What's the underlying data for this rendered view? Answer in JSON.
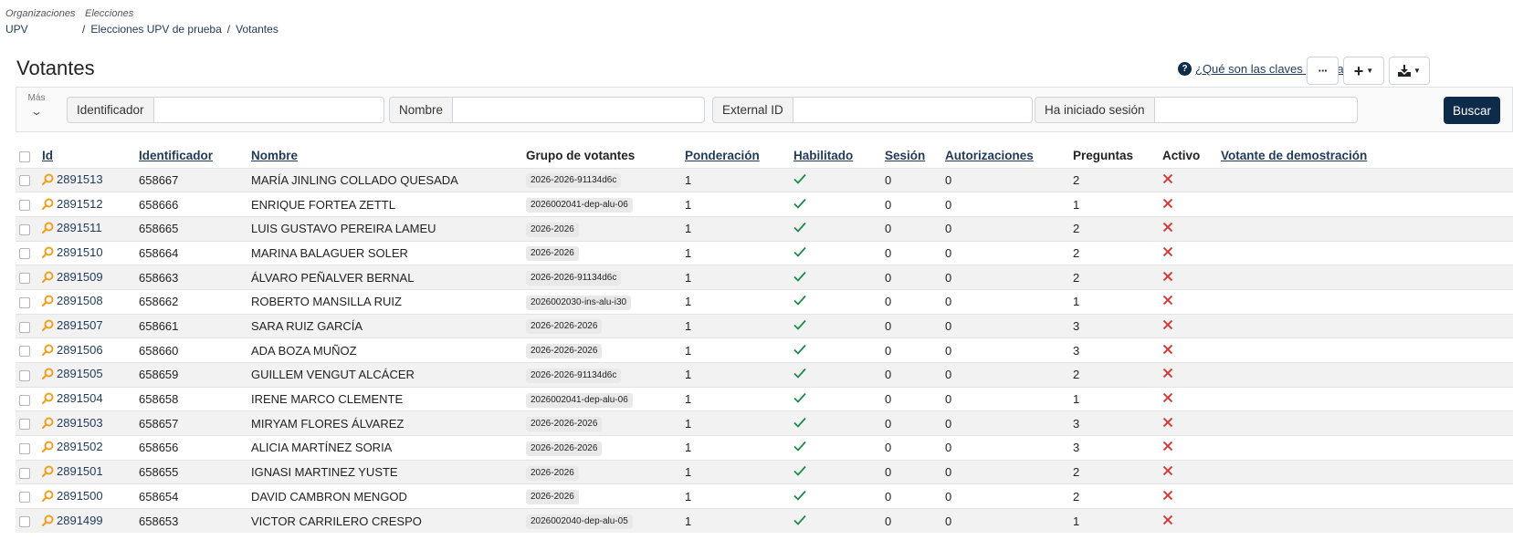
{
  "breadcrumb": {
    "org_caption": "Organizaciones",
    "org_value": "UPV",
    "elections_caption": "Elecciones",
    "elections_value": "Elecciones UPV de prueba",
    "current": "Votantes",
    "separator": "/"
  },
  "header": {
    "title": "Votantes",
    "keys_link": "¿Qué son las claves públicas?",
    "keys_icon_glyph": "?",
    "more_button": "···",
    "add_button": "+",
    "download_button": "download-icon"
  },
  "filters": {
    "more_label": "Más",
    "more_chevron": "⌄",
    "fields": [
      {
        "label": "Identificador",
        "value": ""
      },
      {
        "label": "Nombre",
        "value": ""
      },
      {
        "label": "External ID",
        "value": ""
      },
      {
        "label": "Ha iniciado sesión",
        "value": ""
      }
    ],
    "search_button": "Buscar"
  },
  "table": {
    "columns": {
      "id": "Id",
      "identifier": "Identificador",
      "name": "Nombre",
      "group": "Grupo de votantes",
      "weight": "Ponderación",
      "enabled": "Habilitado",
      "session": "Sesión",
      "authorizations": "Autorizaciones",
      "questions": "Preguntas",
      "active": "Activo",
      "demo": "Votante de demostración"
    },
    "rows": [
      {
        "id": "2891513",
        "identifier": "658667",
        "name": "MARÍA JINLING COLLADO QUESADA",
        "group": "2026-2026-91134d6c",
        "weight": "1",
        "session": "0",
        "authorizations": "0",
        "questions": "2"
      },
      {
        "id": "2891512",
        "identifier": "658666",
        "name": "ENRIQUE FORTEA ZETTL",
        "group": "2026002041-dep-alu-06",
        "weight": "1",
        "session": "0",
        "authorizations": "0",
        "questions": "1"
      },
      {
        "id": "2891511",
        "identifier": "658665",
        "name": "LUIS GUSTAVO PEREIRA LAMEU",
        "group": "2026-2026",
        "weight": "1",
        "session": "0",
        "authorizations": "0",
        "questions": "2"
      },
      {
        "id": "2891510",
        "identifier": "658664",
        "name": "MARINA BALAGUER SOLER",
        "group": "2026-2026",
        "weight": "1",
        "session": "0",
        "authorizations": "0",
        "questions": "2"
      },
      {
        "id": "2891509",
        "identifier": "658663",
        "name": "ÁLVARO PEÑALVER BERNAL",
        "group": "2026-2026-91134d6c",
        "weight": "1",
        "session": "0",
        "authorizations": "0",
        "questions": "2"
      },
      {
        "id": "2891508",
        "identifier": "658662",
        "name": "ROBERTO MANSILLA RUIZ",
        "group": "2026002030-ins-alu-i30",
        "weight": "1",
        "session": "0",
        "authorizations": "0",
        "questions": "1"
      },
      {
        "id": "2891507",
        "identifier": "658661",
        "name": "SARA RUIZ GARCÍA",
        "group": "2026-2026-2026",
        "weight": "1",
        "session": "0",
        "authorizations": "0",
        "questions": "3"
      },
      {
        "id": "2891506",
        "identifier": "658660",
        "name": "ADA BOZA MUÑOZ",
        "group": "2026-2026-2026",
        "weight": "1",
        "session": "0",
        "authorizations": "0",
        "questions": "3"
      },
      {
        "id": "2891505",
        "identifier": "658659",
        "name": "GUILLEM VENGUT ALCÁCER",
        "group": "2026-2026-91134d6c",
        "weight": "1",
        "session": "0",
        "authorizations": "0",
        "questions": "2"
      },
      {
        "id": "2891504",
        "identifier": "658658",
        "name": "IRENE MARCO CLEMENTE",
        "group": "2026002041-dep-alu-06",
        "weight": "1",
        "session": "0",
        "authorizations": "0",
        "questions": "1"
      },
      {
        "id": "2891503",
        "identifier": "658657",
        "name": "MIRYAM FLORES ÁLVAREZ",
        "group": "2026-2026-2026",
        "weight": "1",
        "session": "0",
        "authorizations": "0",
        "questions": "3"
      },
      {
        "id": "2891502",
        "identifier": "658656",
        "name": "ALICIA MARTÍNEZ SORIA",
        "group": "2026-2026-2026",
        "weight": "1",
        "session": "0",
        "authorizations": "0",
        "questions": "3"
      },
      {
        "id": "2891501",
        "identifier": "658655",
        "name": "IGNASI MARTINEZ YUSTE",
        "group": "2026-2026",
        "weight": "1",
        "session": "0",
        "authorizations": "0",
        "questions": "2"
      },
      {
        "id": "2891500",
        "identifier": "658654",
        "name": "DAVID CAMBRON MENGOD",
        "group": "2026-2026",
        "weight": "1",
        "session": "0",
        "authorizations": "0",
        "questions": "2"
      },
      {
        "id": "2891499",
        "identifier": "658653",
        "name": "VICTOR CARRILERO CRESPO",
        "group": "2026002040-dep-alu-05",
        "weight": "1",
        "session": "0",
        "authorizations": "0",
        "questions": "1"
      }
    ]
  },
  "colors": {
    "primary": "#0f2b4a",
    "link": "#1f3a5a",
    "search_icon": "#f0a020",
    "check": "#1e8a4c",
    "cross": "#dc2f2f"
  }
}
